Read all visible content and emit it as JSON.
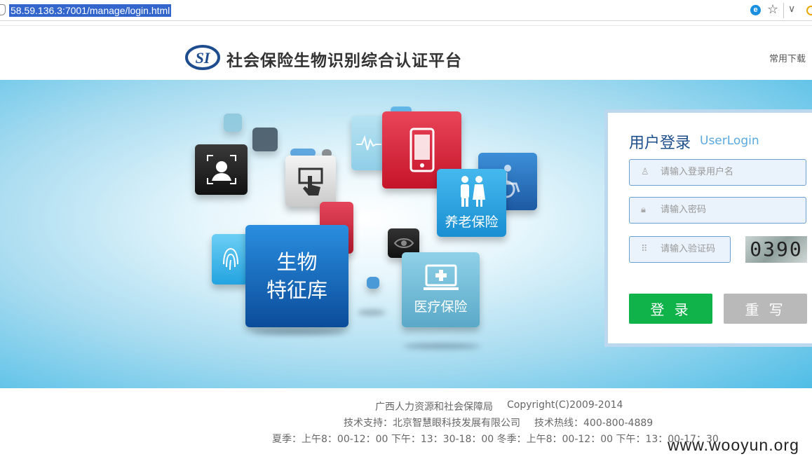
{
  "browser": {
    "url": "58.59.136.3:7001/manage/login.html"
  },
  "header": {
    "logo_text": "SI",
    "title": "社会保险生物识别综合认证平台",
    "download_link": "常用下载"
  },
  "banner": {
    "tiles": {
      "pension": "养老保险",
      "bio_line1": "生物",
      "bio_line2": "特征库",
      "medical": "医疗保险"
    }
  },
  "login": {
    "title": "用户登录",
    "subtitle": "UserLogin",
    "username_placeholder": "请输入登录用户名",
    "password_placeholder": "请输入密码",
    "captcha_placeholder": "请输入验证码",
    "captcha_code": "0390",
    "login_button": "登 录",
    "reset_button": "重 写"
  },
  "footer": {
    "org": "广西人力资源和社会保障局",
    "copyright": "Copyright(C)2009-2014",
    "support": "技术支持：北京智慧眼科技发展有限公司",
    "hotline": "技术热线：400-800-4889",
    "hours": "夏季：上午8：00-12：00 下午：13：30-18：00 冬季：上午8：00-12：00 下午：13：00-17：30"
  },
  "watermark": "www.wooyun.org",
  "colors": {
    "login_button": "#10b34a",
    "reset_button": "#b9b9b9",
    "title_blue": "#1d4f8c"
  }
}
